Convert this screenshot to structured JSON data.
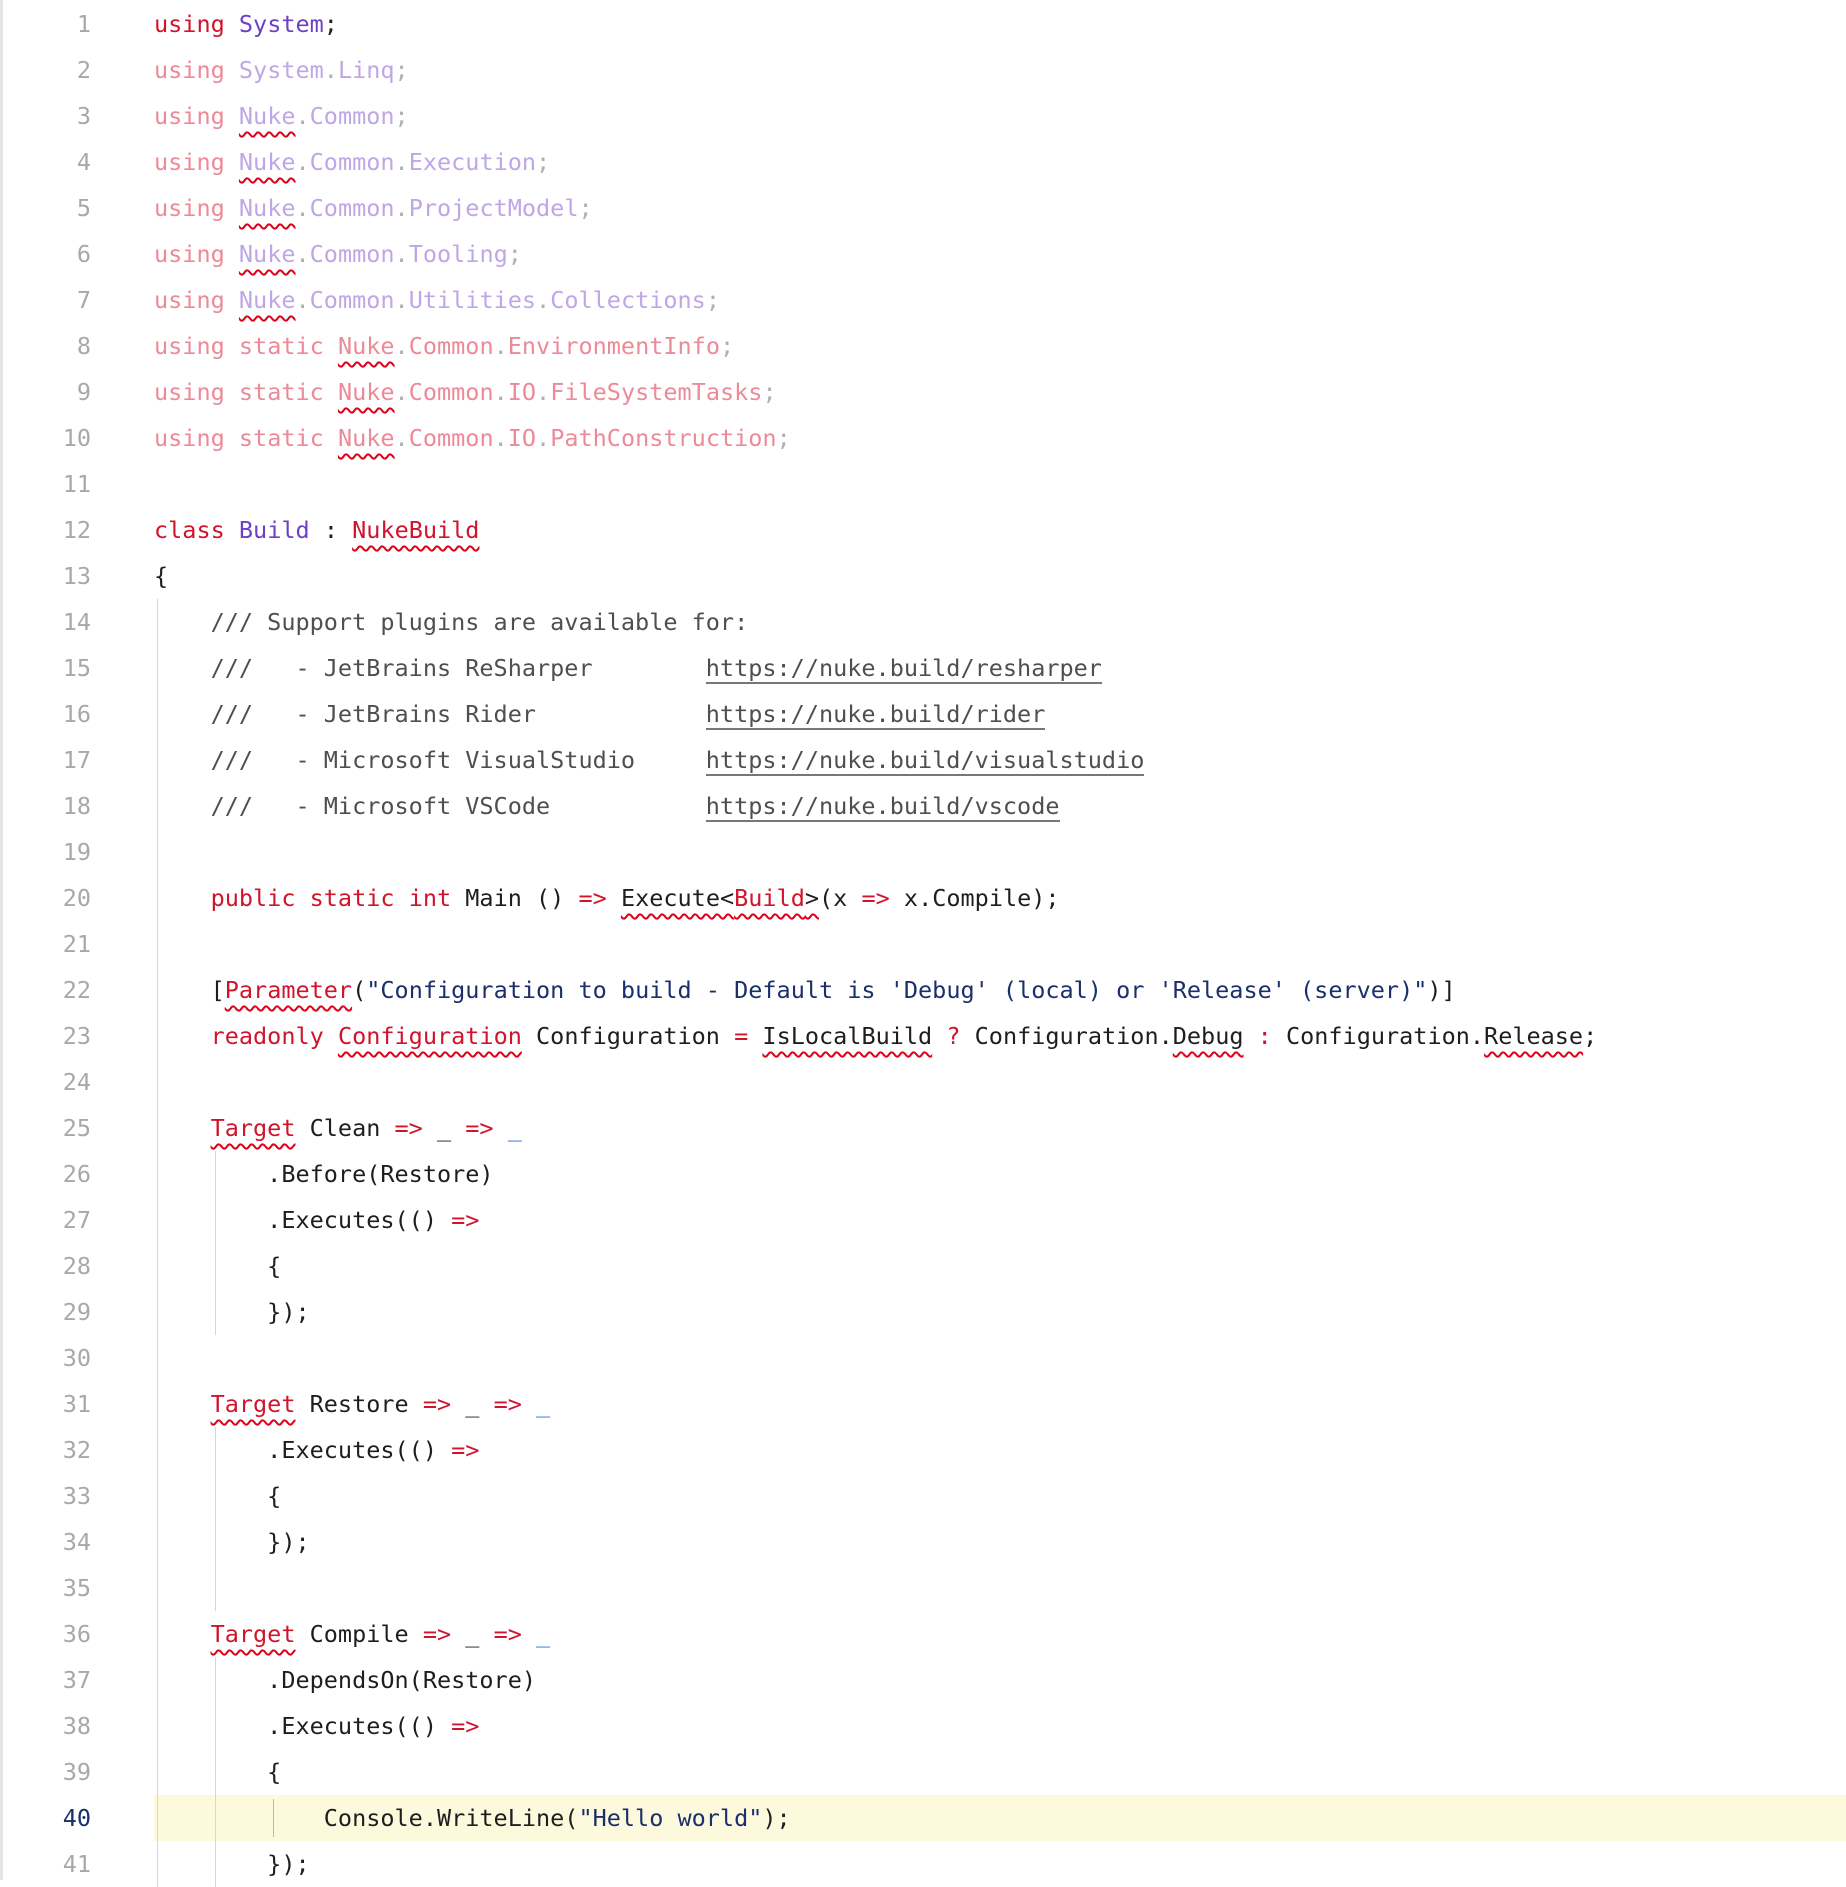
{
  "editor": {
    "language": "C#",
    "current_line": 40,
    "lines": [
      {
        "n": "1",
        "tokens": [
          {
            "t": "using",
            "c": "kw"
          },
          {
            "t": " "
          },
          {
            "t": "System",
            "c": "ns"
          },
          {
            "t": ";",
            "c": "punc"
          }
        ]
      },
      {
        "n": "2",
        "tokens": [
          {
            "t": "using",
            "c": "kw-faded"
          },
          {
            "t": " "
          },
          {
            "t": "System",
            "c": "ns-faded"
          },
          {
            "t": ".",
            "c": "punc-faded"
          },
          {
            "t": "Linq",
            "c": "ns-faded"
          },
          {
            "t": ";",
            "c": "punc-faded"
          }
        ]
      },
      {
        "n": "3",
        "tokens": [
          {
            "t": "using",
            "c": "kw-faded"
          },
          {
            "t": " "
          },
          {
            "t": "Nuke",
            "c": "ns-faded err"
          },
          {
            "t": ".",
            "c": "punc-faded"
          },
          {
            "t": "Common",
            "c": "ns-faded"
          },
          {
            "t": ";",
            "c": "punc-faded"
          }
        ]
      },
      {
        "n": "4",
        "tokens": [
          {
            "t": "using",
            "c": "kw-faded"
          },
          {
            "t": " "
          },
          {
            "t": "Nuke",
            "c": "ns-faded err"
          },
          {
            "t": ".",
            "c": "punc-faded"
          },
          {
            "t": "Common",
            "c": "ns-faded"
          },
          {
            "t": ".",
            "c": "punc-faded"
          },
          {
            "t": "Execution",
            "c": "ns-faded"
          },
          {
            "t": ";",
            "c": "punc-faded"
          }
        ]
      },
      {
        "n": "5",
        "tokens": [
          {
            "t": "using",
            "c": "kw-faded"
          },
          {
            "t": " "
          },
          {
            "t": "Nuke",
            "c": "ns-faded err"
          },
          {
            "t": ".",
            "c": "punc-faded"
          },
          {
            "t": "Common",
            "c": "ns-faded"
          },
          {
            "t": ".",
            "c": "punc-faded"
          },
          {
            "t": "ProjectModel",
            "c": "ns-faded"
          },
          {
            "t": ";",
            "c": "punc-faded"
          }
        ]
      },
      {
        "n": "6",
        "tokens": [
          {
            "t": "using",
            "c": "kw-faded"
          },
          {
            "t": " "
          },
          {
            "t": "Nuke",
            "c": "ns-faded err"
          },
          {
            "t": ".",
            "c": "punc-faded"
          },
          {
            "t": "Common",
            "c": "ns-faded"
          },
          {
            "t": ".",
            "c": "punc-faded"
          },
          {
            "t": "Tooling",
            "c": "ns-faded"
          },
          {
            "t": ";",
            "c": "punc-faded"
          }
        ]
      },
      {
        "n": "7",
        "tokens": [
          {
            "t": "using",
            "c": "kw-faded"
          },
          {
            "t": " "
          },
          {
            "t": "Nuke",
            "c": "ns-faded err"
          },
          {
            "t": ".",
            "c": "punc-faded"
          },
          {
            "t": "Common",
            "c": "ns-faded"
          },
          {
            "t": ".",
            "c": "punc-faded"
          },
          {
            "t": "Utilities",
            "c": "ns-faded"
          },
          {
            "t": ".",
            "c": "punc-faded"
          },
          {
            "t": "Collections",
            "c": "ns-faded"
          },
          {
            "t": ";",
            "c": "punc-faded"
          }
        ]
      },
      {
        "n": "8",
        "tokens": [
          {
            "t": "using",
            "c": "kw-faded"
          },
          {
            "t": " "
          },
          {
            "t": "static",
            "c": "kw-faded"
          },
          {
            "t": " "
          },
          {
            "t": "Nuke",
            "c": "type-faded err"
          },
          {
            "t": ".",
            "c": "punc-faded"
          },
          {
            "t": "Common",
            "c": "type-faded"
          },
          {
            "t": ".",
            "c": "punc-faded"
          },
          {
            "t": "EnvironmentInfo",
            "c": "type-faded"
          },
          {
            "t": ";",
            "c": "punc-faded"
          }
        ]
      },
      {
        "n": "9",
        "tokens": [
          {
            "t": "using",
            "c": "kw-faded"
          },
          {
            "t": " "
          },
          {
            "t": "static",
            "c": "kw-faded"
          },
          {
            "t": " "
          },
          {
            "t": "Nuke",
            "c": "type-faded err"
          },
          {
            "t": ".",
            "c": "punc-faded"
          },
          {
            "t": "Common",
            "c": "type-faded"
          },
          {
            "t": ".",
            "c": "punc-faded"
          },
          {
            "t": "IO",
            "c": "type-faded"
          },
          {
            "t": ".",
            "c": "punc-faded"
          },
          {
            "t": "FileSystemTasks",
            "c": "type-faded"
          },
          {
            "t": ";",
            "c": "punc-faded"
          }
        ]
      },
      {
        "n": "10",
        "tokens": [
          {
            "t": "using",
            "c": "kw-faded"
          },
          {
            "t": " "
          },
          {
            "t": "static",
            "c": "kw-faded"
          },
          {
            "t": " "
          },
          {
            "t": "Nuke",
            "c": "type-faded err"
          },
          {
            "t": ".",
            "c": "punc-faded"
          },
          {
            "t": "Common",
            "c": "type-faded"
          },
          {
            "t": ".",
            "c": "punc-faded"
          },
          {
            "t": "IO",
            "c": "type-faded"
          },
          {
            "t": ".",
            "c": "punc-faded"
          },
          {
            "t": "PathConstruction",
            "c": "type-faded"
          },
          {
            "t": ";",
            "c": "punc-faded"
          }
        ]
      },
      {
        "n": "11",
        "tokens": []
      },
      {
        "n": "12",
        "tokens": [
          {
            "t": "class",
            "c": "kw"
          },
          {
            "t": " "
          },
          {
            "t": "Build",
            "c": "ns"
          },
          {
            "t": " "
          },
          {
            "t": ":",
            "c": "punc"
          },
          {
            "t": " "
          },
          {
            "t": "NukeBuild",
            "c": "type-red err"
          }
        ]
      },
      {
        "n": "13",
        "tokens": [
          {
            "t": "{",
            "c": "punc"
          }
        ]
      },
      {
        "n": "14",
        "tokens": [
          {
            "t": "    "
          },
          {
            "t": "/// Support plugins are available for:",
            "c": "comment"
          }
        ]
      },
      {
        "n": "15",
        "tokens": [
          {
            "t": "    "
          },
          {
            "t": "///   - JetBrains ReSharper        ",
            "c": "comment"
          },
          {
            "t": "https://nuke.build/resharper",
            "c": "link"
          }
        ]
      },
      {
        "n": "16",
        "tokens": [
          {
            "t": "    "
          },
          {
            "t": "///   - JetBrains Rider            ",
            "c": "comment"
          },
          {
            "t": "https://nuke.build/rider",
            "c": "link"
          }
        ]
      },
      {
        "n": "17",
        "tokens": [
          {
            "t": "    "
          },
          {
            "t": "///   - Microsoft VisualStudio     ",
            "c": "comment"
          },
          {
            "t": "https://nuke.build/visualstudio",
            "c": "link"
          }
        ]
      },
      {
        "n": "18",
        "tokens": [
          {
            "t": "    "
          },
          {
            "t": "///   - Microsoft VSCode           ",
            "c": "comment"
          },
          {
            "t": "https://nuke.build/vscode",
            "c": "link"
          }
        ]
      },
      {
        "n": "19",
        "tokens": []
      },
      {
        "n": "20",
        "tokens": [
          {
            "t": "    "
          },
          {
            "t": "public",
            "c": "kw"
          },
          {
            "t": " "
          },
          {
            "t": "static",
            "c": "kw"
          },
          {
            "t": " "
          },
          {
            "t": "int",
            "c": "kw"
          },
          {
            "t": " Main () "
          },
          {
            "t": "=>",
            "c": "kw"
          },
          {
            "t": " "
          },
          {
            "t": "Execute<",
            "c": "err"
          },
          {
            "t": "Build",
            "c": "type-red err"
          },
          {
            "t": ">",
            "c": "err"
          },
          {
            "t": "(x "
          },
          {
            "t": "=>",
            "c": "kw"
          },
          {
            "t": " x.Compile);"
          }
        ]
      },
      {
        "n": "21",
        "tokens": []
      },
      {
        "n": "22",
        "tokens": [
          {
            "t": "    "
          },
          {
            "t": "["
          },
          {
            "t": "Parameter",
            "c": "type-red err"
          },
          {
            "t": "("
          },
          {
            "t": "\"Configuration to build - Default is 'Debug' (local) or 'Release' (server)\"",
            "c": "str"
          },
          {
            "t": ")]"
          }
        ]
      },
      {
        "n": "23",
        "tokens": [
          {
            "t": "    "
          },
          {
            "t": "readonly",
            "c": "kw"
          },
          {
            "t": " "
          },
          {
            "t": "Configuration",
            "c": "type-red err"
          },
          {
            "t": " Configuration "
          },
          {
            "t": "=",
            "c": "kw"
          },
          {
            "t": " "
          },
          {
            "t": "IsLocalBuild",
            "c": "err"
          },
          {
            "t": " "
          },
          {
            "t": "?",
            "c": "kw"
          },
          {
            "t": " Configuration."
          },
          {
            "t": "Debug",
            "c": "err"
          },
          {
            "t": " "
          },
          {
            "t": ":",
            "c": "kw"
          },
          {
            "t": " Configuration."
          },
          {
            "t": "Release",
            "c": "err"
          },
          {
            "t": ";"
          }
        ]
      },
      {
        "n": "24",
        "tokens": []
      },
      {
        "n": "25",
        "tokens": [
          {
            "t": "    "
          },
          {
            "t": "Target",
            "c": "type-red err"
          },
          {
            "t": " Clean "
          },
          {
            "t": "=>",
            "c": "kw"
          },
          {
            "t": " _ "
          },
          {
            "t": "=>",
            "c": "kw"
          },
          {
            "t": " "
          },
          {
            "t": "_",
            "c": "blue"
          }
        ]
      },
      {
        "n": "26",
        "tokens": [
          {
            "t": "        .Before(Restore)"
          }
        ]
      },
      {
        "n": "27",
        "tokens": [
          {
            "t": "        .Executes(() "
          },
          {
            "t": "=>",
            "c": "kw"
          }
        ]
      },
      {
        "n": "28",
        "tokens": [
          {
            "t": "        {"
          }
        ]
      },
      {
        "n": "29",
        "tokens": [
          {
            "t": "        });"
          }
        ]
      },
      {
        "n": "30",
        "tokens": []
      },
      {
        "n": "31",
        "tokens": [
          {
            "t": "    "
          },
          {
            "t": "Target",
            "c": "type-red err"
          },
          {
            "t": " Restore "
          },
          {
            "t": "=>",
            "c": "kw"
          },
          {
            "t": " _ "
          },
          {
            "t": "=>",
            "c": "kw"
          },
          {
            "t": " "
          },
          {
            "t": "_",
            "c": "blue"
          }
        ]
      },
      {
        "n": "32",
        "tokens": [
          {
            "t": "        .Executes(() "
          },
          {
            "t": "=>",
            "c": "kw"
          }
        ]
      },
      {
        "n": "33",
        "tokens": [
          {
            "t": "        {"
          }
        ]
      },
      {
        "n": "34",
        "tokens": [
          {
            "t": "        });"
          }
        ]
      },
      {
        "n": "35",
        "tokens": []
      },
      {
        "n": "36",
        "tokens": [
          {
            "t": "    "
          },
          {
            "t": "Target",
            "c": "type-red err"
          },
          {
            "t": " Compile "
          },
          {
            "t": "=>",
            "c": "kw"
          },
          {
            "t": " _ "
          },
          {
            "t": "=>",
            "c": "kw"
          },
          {
            "t": " "
          },
          {
            "t": "_",
            "c": "blue"
          }
        ]
      },
      {
        "n": "37",
        "tokens": [
          {
            "t": "        .DependsOn(Restore)"
          }
        ]
      },
      {
        "n": "38",
        "tokens": [
          {
            "t": "        .Executes(() "
          },
          {
            "t": "=>",
            "c": "kw"
          }
        ]
      },
      {
        "n": "39",
        "tokens": [
          {
            "t": "        {"
          }
        ]
      },
      {
        "n": "40",
        "tokens": [
          {
            "t": "            Console.WriteLine("
          },
          {
            "t": "\"Hello world\"",
            "c": "str"
          },
          {
            "t": ");"
          }
        ]
      },
      {
        "n": "41",
        "tokens": [
          {
            "t": "        });"
          }
        ]
      }
    ]
  }
}
